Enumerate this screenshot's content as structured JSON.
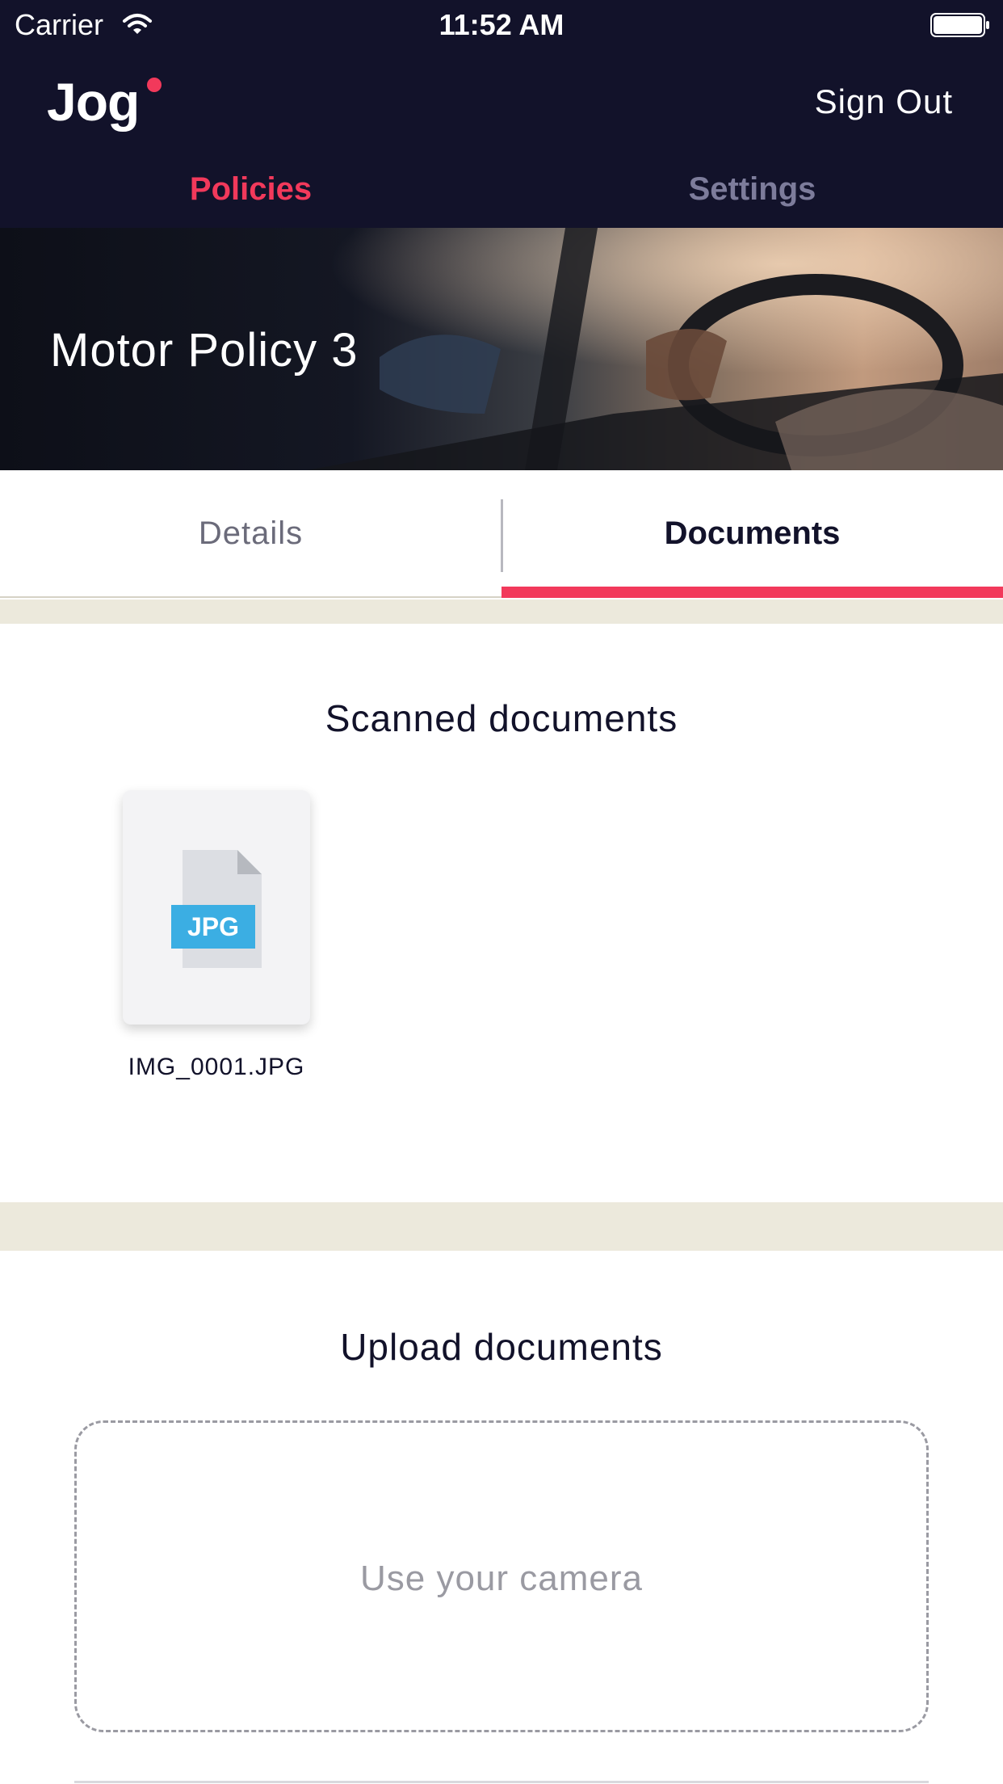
{
  "status_bar": {
    "carrier": "Carrier",
    "time": "11:52 AM"
  },
  "header": {
    "logo": "Jog",
    "sign_out": "Sign Out"
  },
  "top_nav": {
    "items": [
      {
        "label": "Policies",
        "active": true
      },
      {
        "label": "Settings",
        "active": false
      }
    ]
  },
  "banner": {
    "title": "Motor Policy 3"
  },
  "tabs": {
    "items": [
      {
        "label": "Details",
        "active": false
      },
      {
        "label": "Documents",
        "active": true
      }
    ]
  },
  "scanned": {
    "title": "Scanned documents",
    "files": [
      {
        "name": "IMG_0001.JPG",
        "type_label": "JPG"
      }
    ]
  },
  "upload": {
    "title": "Upload documents",
    "camera_label": "Use your camera"
  },
  "colors": {
    "accent": "#f2395b",
    "header_bg": "#12122a",
    "divider_band": "#ece9dc",
    "file_badge": "#3baee3"
  }
}
